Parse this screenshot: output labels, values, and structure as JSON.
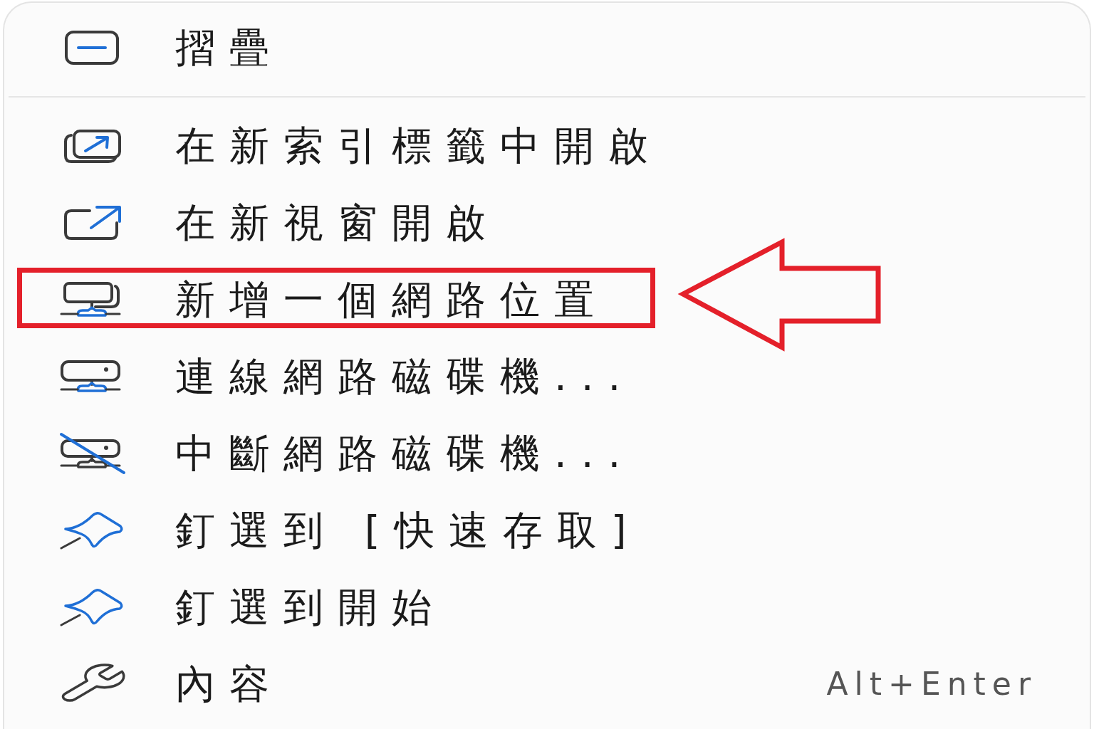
{
  "context_menu": {
    "groups": [
      {
        "items": [
          {
            "label": "摺疊",
            "highlighted": false
          }
        ]
      },
      {
        "items": [
          {
            "label": "在新索引標籤中開啟",
            "highlighted": false
          },
          {
            "label": "在新視窗開啟",
            "highlighted": false
          },
          {
            "label": "新增一個網路位置",
            "highlighted": true
          },
          {
            "label": "連線網路磁碟機...",
            "highlighted": false
          },
          {
            "label": "中斷網路磁碟機...",
            "highlighted": false
          },
          {
            "label": "釘選到 [快速存取]",
            "highlighted": false
          },
          {
            "label": "釘選到開始",
            "highlighted": false
          },
          {
            "label": "內容",
            "shortcut": "Alt+Enter",
            "highlighted": false
          }
        ]
      }
    ]
  }
}
